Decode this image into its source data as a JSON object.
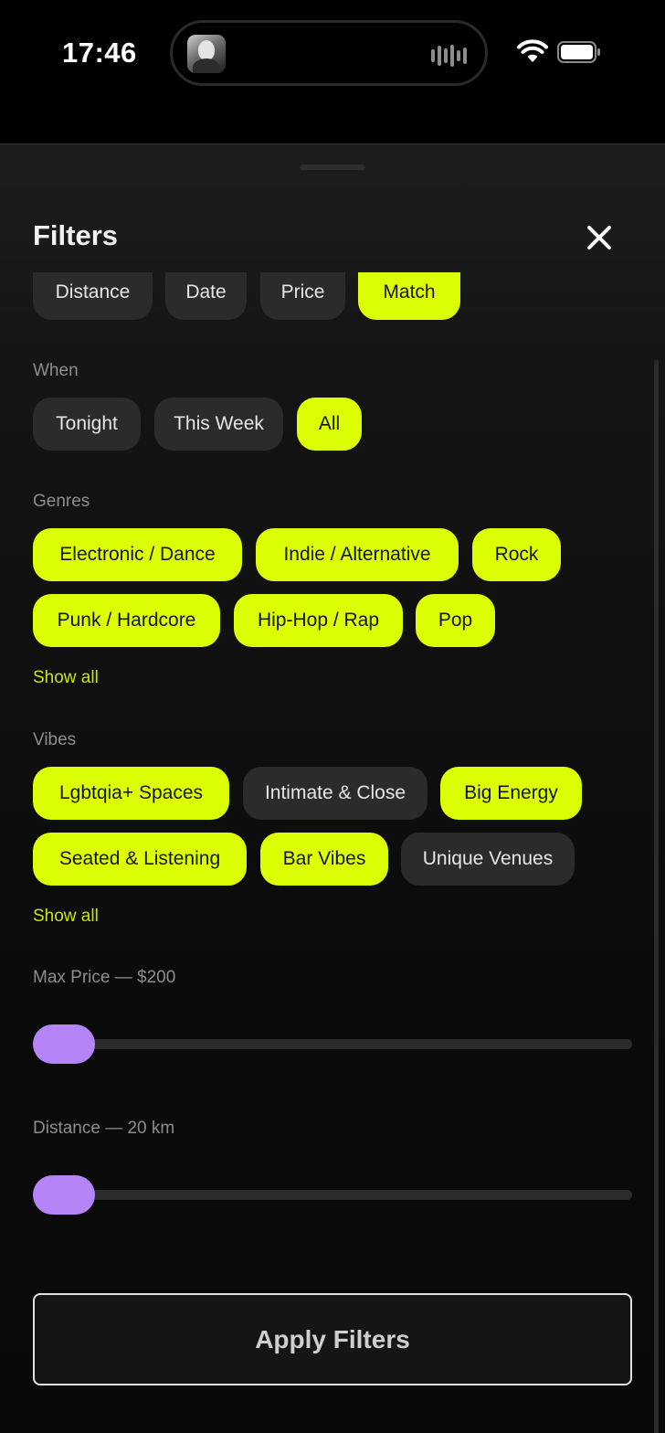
{
  "status_bar": {
    "time": "17:46"
  },
  "sheet": {
    "title": "Filters"
  },
  "sort": {
    "options": [
      {
        "label": "Distance",
        "selected": false
      },
      {
        "label": "Date",
        "selected": false
      },
      {
        "label": "Price",
        "selected": false
      },
      {
        "label": "Match",
        "selected": true
      }
    ]
  },
  "when": {
    "label": "When",
    "options": [
      {
        "label": "Tonight",
        "selected": false
      },
      {
        "label": "This Week",
        "selected": false
      },
      {
        "label": "All",
        "selected": true
      }
    ]
  },
  "genres": {
    "label": "Genres",
    "options": [
      {
        "label": "Electronic / Dance",
        "selected": true
      },
      {
        "label": "Indie / Alternative",
        "selected": true
      },
      {
        "label": "Rock",
        "selected": true
      },
      {
        "label": "Punk / Hardcore",
        "selected": true
      },
      {
        "label": "Hip-Hop / Rap",
        "selected": true
      },
      {
        "label": "Pop",
        "selected": true
      }
    ],
    "show_all": "Show all"
  },
  "vibes": {
    "label": "Vibes",
    "options": [
      {
        "label": "Lgbtqia+ Spaces",
        "selected": true
      },
      {
        "label": "Intimate & Close",
        "selected": false
      },
      {
        "label": "Big Energy",
        "selected": true
      },
      {
        "label": "Seated & Listening",
        "selected": true
      },
      {
        "label": "Bar Vibes",
        "selected": true
      },
      {
        "label": "Unique Venues",
        "selected": false
      }
    ],
    "show_all": "Show all"
  },
  "max_price": {
    "label": "Max Price — $200",
    "position": 0
  },
  "distance": {
    "label": "Distance — 20 km",
    "position": 0
  },
  "apply_button": {
    "label": "Apply Filters"
  },
  "colors": {
    "accent": "#dcff06",
    "slider_thumb": "#b585f8",
    "chip_inactive": "#2b2b2b",
    "link": "#c6e60b"
  }
}
